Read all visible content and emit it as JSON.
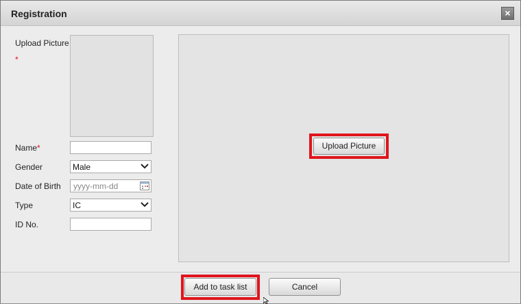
{
  "dialog": {
    "title": "Registration"
  },
  "form": {
    "upload_picture_label": "Upload Picture",
    "required_mark": "*",
    "name_label": "Name",
    "name_value": "",
    "gender_label": "Gender",
    "gender_value": "Male",
    "dob_label": "Date of Birth",
    "dob_placeholder": "yyyy-mm-dd",
    "type_label": "Type",
    "type_value": "IC",
    "id_label": "ID No.",
    "id_value": ""
  },
  "preview": {
    "upload_button_label": "Upload Picture"
  },
  "footer": {
    "add_label": "Add to task list",
    "cancel_label": "Cancel"
  },
  "colors": {
    "highlight": "#e0141c",
    "required": "#dd1111"
  },
  "icons": [
    "close-icon",
    "chevron-down-icon",
    "calendar-icon",
    "mouse-cursor-icon"
  ]
}
